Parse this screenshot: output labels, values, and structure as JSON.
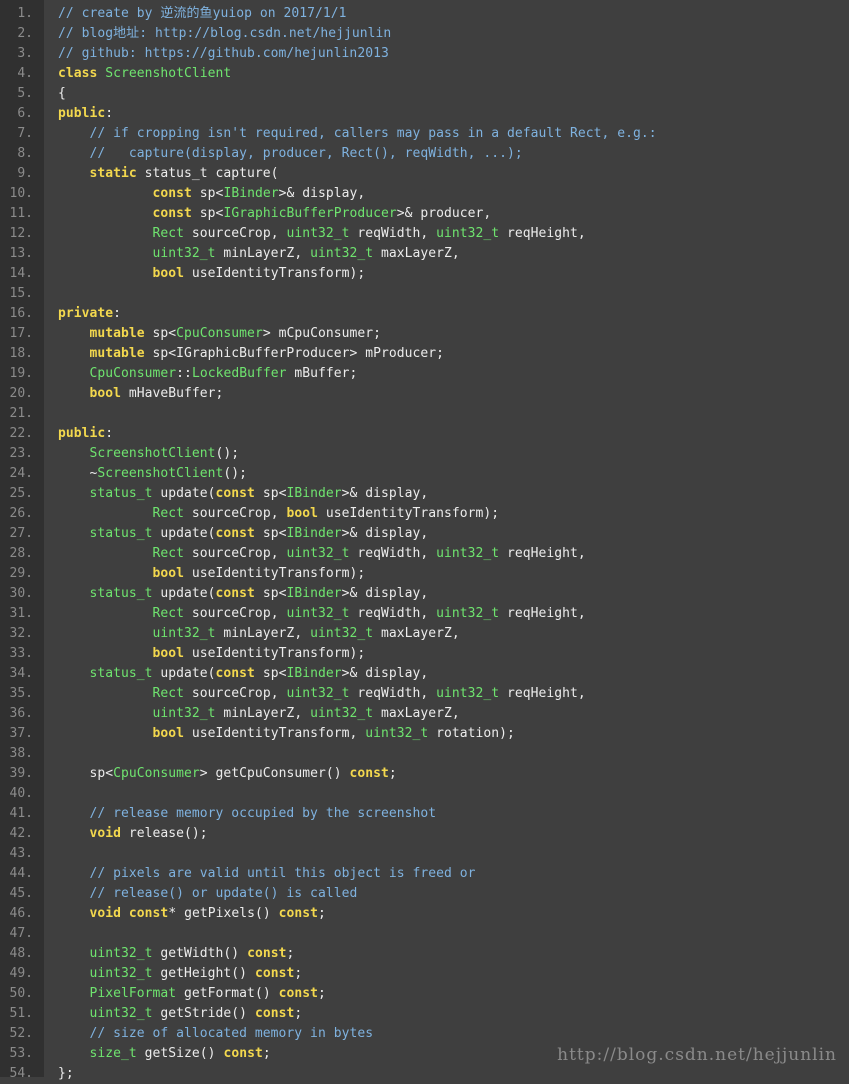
{
  "colors": {
    "background": "#3f3f3f",
    "gutter": "#303030",
    "line_number": "#8b8b8b",
    "comment": "#7fb2df",
    "keyword": "#f3d84e",
    "type": "#6fe46f",
    "plain": "#ececec"
  },
  "lines": [
    {
      "n": "1.",
      "tokens": [
        [
          "c",
          "// create by 逆流的鱼yuiop on 2017/1/1"
        ]
      ]
    },
    {
      "n": "2.",
      "tokens": [
        [
          "c",
          "// blog地址: http://blog.csdn.net/hejjunlin"
        ]
      ]
    },
    {
      "n": "3.",
      "tokens": [
        [
          "c",
          "// github: https://github.com/hejunlin2013"
        ]
      ]
    },
    {
      "n": "4.",
      "tokens": [
        [
          "k",
          "class"
        ],
        [
          "p",
          " "
        ],
        [
          "t",
          "ScreenshotClient"
        ]
      ]
    },
    {
      "n": "5.",
      "tokens": [
        [
          "p",
          "{"
        ]
      ]
    },
    {
      "n": "6.",
      "tokens": [
        [
          "k",
          "public"
        ],
        [
          "p",
          ":"
        ]
      ]
    },
    {
      "n": "7.",
      "tokens": [
        [
          "p",
          "    "
        ],
        [
          "c",
          "// if cropping isn't required, callers may pass in a default Rect, e.g.:"
        ]
      ]
    },
    {
      "n": "8.",
      "tokens": [
        [
          "p",
          "    "
        ],
        [
          "c",
          "//   capture(display, producer, Rect(), reqWidth, ...);"
        ]
      ]
    },
    {
      "n": "9.",
      "tokens": [
        [
          "p",
          "    "
        ],
        [
          "k",
          "static"
        ],
        [
          "p",
          " status_t capture("
        ]
      ]
    },
    {
      "n": "10.",
      "tokens": [
        [
          "p",
          "            "
        ],
        [
          "k",
          "const"
        ],
        [
          "p",
          " sp<"
        ],
        [
          "t",
          "IBinder"
        ],
        [
          "p",
          ">& display,"
        ]
      ]
    },
    {
      "n": "11.",
      "tokens": [
        [
          "p",
          "            "
        ],
        [
          "k",
          "const"
        ],
        [
          "p",
          " sp<"
        ],
        [
          "t",
          "IGraphicBufferProducer"
        ],
        [
          "p",
          ">& producer,"
        ]
      ]
    },
    {
      "n": "12.",
      "tokens": [
        [
          "p",
          "            "
        ],
        [
          "t",
          "Rect"
        ],
        [
          "p",
          " sourceCrop, "
        ],
        [
          "t",
          "uint32_t"
        ],
        [
          "p",
          " reqWidth, "
        ],
        [
          "t",
          "uint32_t"
        ],
        [
          "p",
          " reqHeight,"
        ]
      ]
    },
    {
      "n": "13.",
      "tokens": [
        [
          "p",
          "            "
        ],
        [
          "t",
          "uint32_t"
        ],
        [
          "p",
          " minLayerZ, "
        ],
        [
          "t",
          "uint32_t"
        ],
        [
          "p",
          " maxLayerZ,"
        ]
      ]
    },
    {
      "n": "14.",
      "tokens": [
        [
          "p",
          "            "
        ],
        [
          "k",
          "bool"
        ],
        [
          "p",
          " useIdentityTransform);"
        ]
      ]
    },
    {
      "n": "15.",
      "tokens": []
    },
    {
      "n": "16.",
      "tokens": [
        [
          "k",
          "private"
        ],
        [
          "p",
          ":"
        ]
      ]
    },
    {
      "n": "17.",
      "tokens": [
        [
          "p",
          "    "
        ],
        [
          "k",
          "mutable"
        ],
        [
          "p",
          " sp<"
        ],
        [
          "t",
          "CpuConsumer"
        ],
        [
          "p",
          "> mCpuConsumer;"
        ]
      ]
    },
    {
      "n": "18.",
      "tokens": [
        [
          "p",
          "    "
        ],
        [
          "k",
          "mutable"
        ],
        [
          "p",
          " sp<IGraphicBufferProducer> mProducer;"
        ]
      ]
    },
    {
      "n": "19.",
      "tokens": [
        [
          "p",
          "    "
        ],
        [
          "t",
          "CpuConsumer"
        ],
        [
          "p",
          "::"
        ],
        [
          "t",
          "LockedBuffer"
        ],
        [
          "p",
          " mBuffer;"
        ]
      ]
    },
    {
      "n": "20.",
      "tokens": [
        [
          "p",
          "    "
        ],
        [
          "k",
          "bool"
        ],
        [
          "p",
          " mHaveBuffer;"
        ]
      ]
    },
    {
      "n": "21.",
      "tokens": []
    },
    {
      "n": "22.",
      "tokens": [
        [
          "k",
          "public"
        ],
        [
          "p",
          ":"
        ]
      ]
    },
    {
      "n": "23.",
      "tokens": [
        [
          "p",
          "    "
        ],
        [
          "t",
          "ScreenshotClient"
        ],
        [
          "p",
          "();"
        ]
      ]
    },
    {
      "n": "24.",
      "tokens": [
        [
          "p",
          "    ~"
        ],
        [
          "t",
          "ScreenshotClient"
        ],
        [
          "p",
          "();"
        ]
      ]
    },
    {
      "n": "25.",
      "tokens": [
        [
          "p",
          "    "
        ],
        [
          "t",
          "status_t"
        ],
        [
          "p",
          " update("
        ],
        [
          "k",
          "const"
        ],
        [
          "p",
          " sp<"
        ],
        [
          "t",
          "IBinder"
        ],
        [
          "p",
          ">& display,"
        ]
      ]
    },
    {
      "n": "26.",
      "tokens": [
        [
          "p",
          "            "
        ],
        [
          "t",
          "Rect"
        ],
        [
          "p",
          " sourceCrop, "
        ],
        [
          "k",
          "bool"
        ],
        [
          "p",
          " useIdentityTransform);"
        ]
      ]
    },
    {
      "n": "27.",
      "tokens": [
        [
          "p",
          "    "
        ],
        [
          "t",
          "status_t"
        ],
        [
          "p",
          " update("
        ],
        [
          "k",
          "const"
        ],
        [
          "p",
          " sp<"
        ],
        [
          "t",
          "IBinder"
        ],
        [
          "p",
          ">& display,"
        ]
      ]
    },
    {
      "n": "28.",
      "tokens": [
        [
          "p",
          "            "
        ],
        [
          "t",
          "Rect"
        ],
        [
          "p",
          " sourceCrop, "
        ],
        [
          "t",
          "uint32_t"
        ],
        [
          "p",
          " reqWidth, "
        ],
        [
          "t",
          "uint32_t"
        ],
        [
          "p",
          " reqHeight,"
        ]
      ]
    },
    {
      "n": "29.",
      "tokens": [
        [
          "p",
          "            "
        ],
        [
          "k",
          "bool"
        ],
        [
          "p",
          " useIdentityTransform);"
        ]
      ]
    },
    {
      "n": "30.",
      "tokens": [
        [
          "p",
          "    "
        ],
        [
          "t",
          "status_t"
        ],
        [
          "p",
          " update("
        ],
        [
          "k",
          "const"
        ],
        [
          "p",
          " sp<"
        ],
        [
          "t",
          "IBinder"
        ],
        [
          "p",
          ">& display,"
        ]
      ]
    },
    {
      "n": "31.",
      "tokens": [
        [
          "p",
          "            "
        ],
        [
          "t",
          "Rect"
        ],
        [
          "p",
          " sourceCrop, "
        ],
        [
          "t",
          "uint32_t"
        ],
        [
          "p",
          " reqWidth, "
        ],
        [
          "t",
          "uint32_t"
        ],
        [
          "p",
          " reqHeight,"
        ]
      ]
    },
    {
      "n": "32.",
      "tokens": [
        [
          "p",
          "            "
        ],
        [
          "t",
          "uint32_t"
        ],
        [
          "p",
          " minLayerZ, "
        ],
        [
          "t",
          "uint32_t"
        ],
        [
          "p",
          " maxLayerZ,"
        ]
      ]
    },
    {
      "n": "33.",
      "tokens": [
        [
          "p",
          "            "
        ],
        [
          "k",
          "bool"
        ],
        [
          "p",
          " useIdentityTransform);"
        ]
      ]
    },
    {
      "n": "34.",
      "tokens": [
        [
          "p",
          "    "
        ],
        [
          "t",
          "status_t"
        ],
        [
          "p",
          " update("
        ],
        [
          "k",
          "const"
        ],
        [
          "p",
          " sp<"
        ],
        [
          "t",
          "IBinder"
        ],
        [
          "p",
          ">& display,"
        ]
      ]
    },
    {
      "n": "35.",
      "tokens": [
        [
          "p",
          "            "
        ],
        [
          "t",
          "Rect"
        ],
        [
          "p",
          " sourceCrop, "
        ],
        [
          "t",
          "uint32_t"
        ],
        [
          "p",
          " reqWidth, "
        ],
        [
          "t",
          "uint32_t"
        ],
        [
          "p",
          " reqHeight,"
        ]
      ]
    },
    {
      "n": "36.",
      "tokens": [
        [
          "p",
          "            "
        ],
        [
          "t",
          "uint32_t"
        ],
        [
          "p",
          " minLayerZ, "
        ],
        [
          "t",
          "uint32_t"
        ],
        [
          "p",
          " maxLayerZ,"
        ]
      ]
    },
    {
      "n": "37.",
      "tokens": [
        [
          "p",
          "            "
        ],
        [
          "k",
          "bool"
        ],
        [
          "p",
          " useIdentityTransform, "
        ],
        [
          "t",
          "uint32_t"
        ],
        [
          "p",
          " rotation);"
        ]
      ]
    },
    {
      "n": "38.",
      "tokens": []
    },
    {
      "n": "39.",
      "tokens": [
        [
          "p",
          "    sp<"
        ],
        [
          "t",
          "CpuConsumer"
        ],
        [
          "p",
          "> getCpuConsumer() "
        ],
        [
          "k",
          "const"
        ],
        [
          "p",
          ";"
        ]
      ]
    },
    {
      "n": "40.",
      "tokens": []
    },
    {
      "n": "41.",
      "tokens": [
        [
          "p",
          "    "
        ],
        [
          "c",
          "// release memory occupied by the screenshot"
        ]
      ]
    },
    {
      "n": "42.",
      "tokens": [
        [
          "p",
          "    "
        ],
        [
          "k",
          "void"
        ],
        [
          "p",
          " release();"
        ]
      ]
    },
    {
      "n": "43.",
      "tokens": []
    },
    {
      "n": "44.",
      "tokens": [
        [
          "p",
          "    "
        ],
        [
          "c",
          "// pixels are valid until this object is freed or"
        ]
      ]
    },
    {
      "n": "45.",
      "tokens": [
        [
          "p",
          "    "
        ],
        [
          "c",
          "// release() or update() is called"
        ]
      ]
    },
    {
      "n": "46.",
      "tokens": [
        [
          "p",
          "    "
        ],
        [
          "k",
          "void"
        ],
        [
          "p",
          " "
        ],
        [
          "k",
          "const"
        ],
        [
          "p",
          "* getPixels() "
        ],
        [
          "k",
          "const"
        ],
        [
          "p",
          ";"
        ]
      ]
    },
    {
      "n": "47.",
      "tokens": []
    },
    {
      "n": "48.",
      "tokens": [
        [
          "p",
          "    "
        ],
        [
          "t",
          "uint32_t"
        ],
        [
          "p",
          " getWidth() "
        ],
        [
          "k",
          "const"
        ],
        [
          "p",
          ";"
        ]
      ]
    },
    {
      "n": "49.",
      "tokens": [
        [
          "p",
          "    "
        ],
        [
          "t",
          "uint32_t"
        ],
        [
          "p",
          " getHeight() "
        ],
        [
          "k",
          "const"
        ],
        [
          "p",
          ";"
        ]
      ]
    },
    {
      "n": "50.",
      "tokens": [
        [
          "p",
          "    "
        ],
        [
          "t",
          "PixelFormat"
        ],
        [
          "p",
          " getFormat() "
        ],
        [
          "k",
          "const"
        ],
        [
          "p",
          ";"
        ]
      ]
    },
    {
      "n": "51.",
      "tokens": [
        [
          "p",
          "    "
        ],
        [
          "t",
          "uint32_t"
        ],
        [
          "p",
          " getStride() "
        ],
        [
          "k",
          "const"
        ],
        [
          "p",
          ";"
        ]
      ]
    },
    {
      "n": "52.",
      "tokens": [
        [
          "p",
          "    "
        ],
        [
          "c",
          "// size of allocated memory in bytes"
        ]
      ]
    },
    {
      "n": "53.",
      "tokens": [
        [
          "p",
          "    "
        ],
        [
          "t",
          "size_t"
        ],
        [
          "p",
          " getSize() "
        ],
        [
          "k",
          "const"
        ],
        [
          "p",
          ";"
        ]
      ]
    },
    {
      "n": "54.",
      "tokens": [
        [
          "p",
          "};"
        ]
      ]
    }
  ],
  "watermark": "http://blog.csdn.net/hejjunlin"
}
